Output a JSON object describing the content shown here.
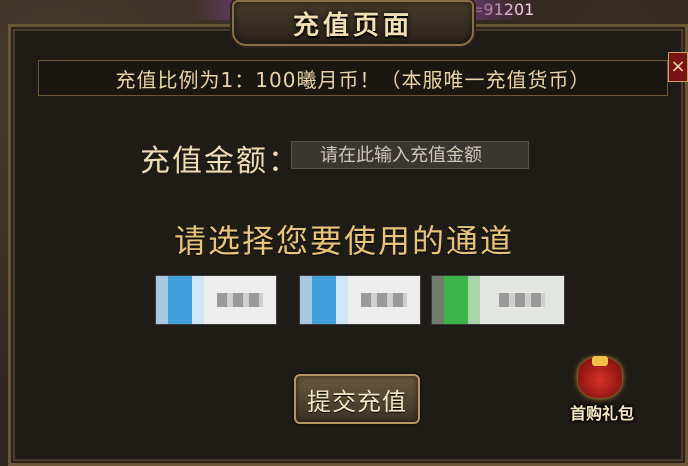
{
  "window": {
    "title": "充值页面"
  },
  "hud": {
    "number": "=91201"
  },
  "header": {
    "ratio_text": "充值比例为1：100曦月币！（本服唯一充值货币）"
  },
  "form": {
    "amount_label": "充值金额：",
    "amount_placeholder": "请在此输入充值金额",
    "amount_value": ""
  },
  "channels": {
    "heading": "请选择您要使用的通道",
    "items": [
      {
        "icon": "payment-logo-icon",
        "color": "#3f9edb"
      },
      {
        "icon": "payment-logo-icon",
        "color": "#3f9edb"
      },
      {
        "icon": "payment-logo-icon",
        "color": "#3bb54a"
      }
    ]
  },
  "actions": {
    "submit_label": "提交充值",
    "close_label": "×"
  },
  "gift": {
    "label": "首购礼包",
    "icon": "gift-bag-icon"
  },
  "colors": {
    "accent": "#e8c37b",
    "frame": "#6a5536",
    "close": "#7a1414"
  }
}
